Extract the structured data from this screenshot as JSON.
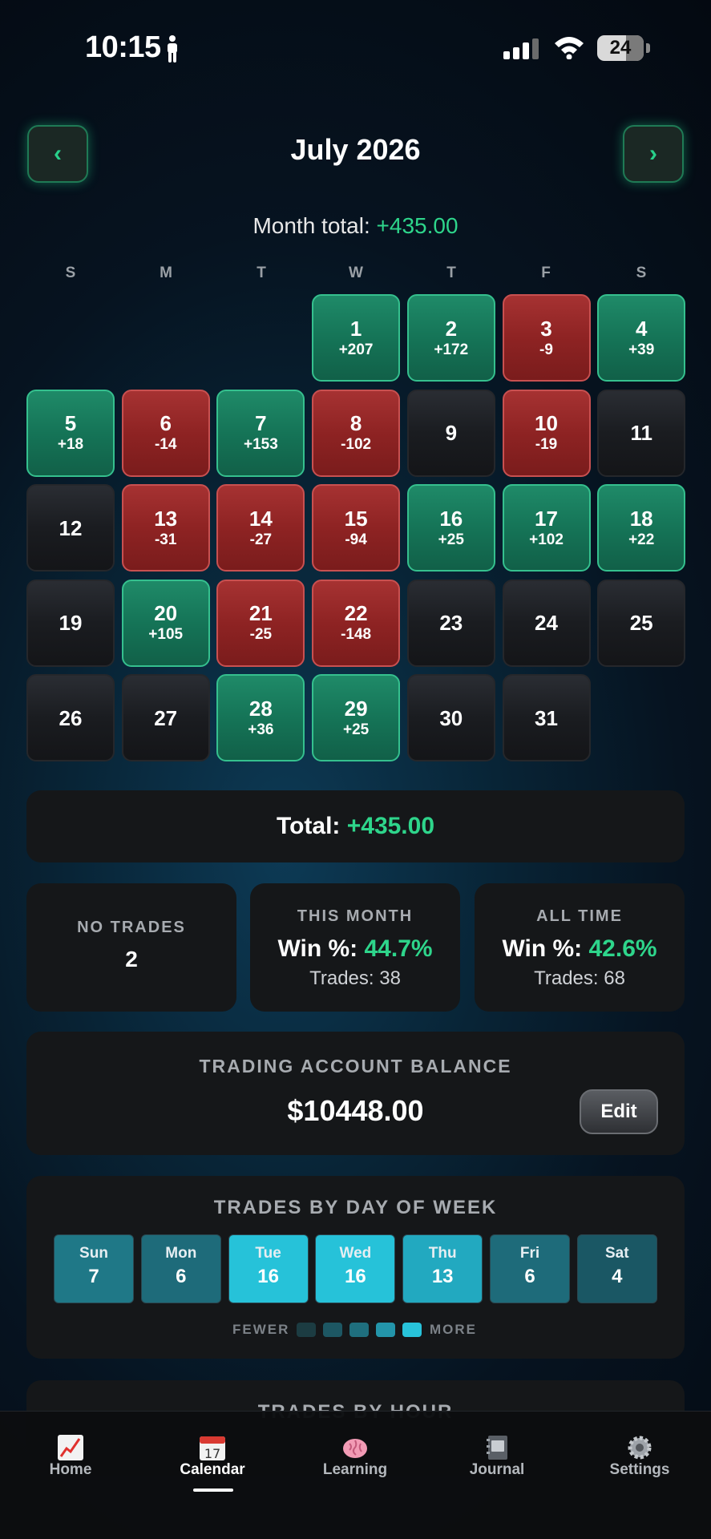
{
  "status_bar": {
    "time": "10:15",
    "battery": "24"
  },
  "header": {
    "prev_label": "‹",
    "next_label": "›",
    "title": "July 2026"
  },
  "month_total": {
    "label": "Month total: ",
    "value": "+435.00"
  },
  "weekdays": [
    "S",
    "M",
    "T",
    "W",
    "T",
    "F",
    "S"
  ],
  "calendar": [
    {
      "day": "1",
      "pnl": "+207",
      "status": "win"
    },
    {
      "day": "2",
      "pnl": "+172",
      "status": "win"
    },
    {
      "day": "3",
      "pnl": "-9",
      "status": "loss"
    },
    {
      "day": "4",
      "pnl": "+39",
      "status": "win"
    },
    {
      "day": "5",
      "pnl": "+18",
      "status": "win"
    },
    {
      "day": "6",
      "pnl": "-14",
      "status": "loss"
    },
    {
      "day": "7",
      "pnl": "+153",
      "status": "win"
    },
    {
      "day": "8",
      "pnl": "-102",
      "status": "loss"
    },
    {
      "day": "9",
      "pnl": "",
      "status": "none"
    },
    {
      "day": "10",
      "pnl": "-19",
      "status": "loss"
    },
    {
      "day": "11",
      "pnl": "",
      "status": "none"
    },
    {
      "day": "12",
      "pnl": "",
      "status": "none"
    },
    {
      "day": "13",
      "pnl": "-31",
      "status": "loss"
    },
    {
      "day": "14",
      "pnl": "-27",
      "status": "loss"
    },
    {
      "day": "15",
      "pnl": "-94",
      "status": "loss"
    },
    {
      "day": "16",
      "pnl": "+25",
      "status": "win"
    },
    {
      "day": "17",
      "pnl": "+102",
      "status": "win"
    },
    {
      "day": "18",
      "pnl": "+22",
      "status": "win"
    },
    {
      "day": "19",
      "pnl": "",
      "status": "none"
    },
    {
      "day": "20",
      "pnl": "+105",
      "status": "win"
    },
    {
      "day": "21",
      "pnl": "-25",
      "status": "loss"
    },
    {
      "day": "22",
      "pnl": "-148",
      "status": "loss"
    },
    {
      "day": "23",
      "pnl": "",
      "status": "none"
    },
    {
      "day": "24",
      "pnl": "",
      "status": "none"
    },
    {
      "day": "25",
      "pnl": "",
      "status": "none"
    },
    {
      "day": "26",
      "pnl": "",
      "status": "none"
    },
    {
      "day": "27",
      "pnl": "",
      "status": "none"
    },
    {
      "day": "28",
      "pnl": "+36",
      "status": "win"
    },
    {
      "day": "29",
      "pnl": "+25",
      "status": "win"
    },
    {
      "day": "30",
      "pnl": "",
      "status": "none"
    },
    {
      "day": "31",
      "pnl": "",
      "status": "none"
    }
  ],
  "total": {
    "label": "Total: ",
    "value": "+435.00"
  },
  "stats": {
    "no_trades": {
      "label": "NO TRADES",
      "value": "2"
    },
    "this_month": {
      "label": "THIS MONTH",
      "win_label": "Win %: ",
      "win_value": "44.7%",
      "trades": "Trades: 38"
    },
    "all_time": {
      "label": "ALL TIME",
      "win_label": "Win %: ",
      "win_value": "42.6%",
      "trades": "Trades: 68"
    }
  },
  "balance": {
    "label": "TRADING ACCOUNT BALANCE",
    "value": "$10448.00",
    "edit_label": "Edit"
  },
  "trades_by_day": {
    "title": "TRADES BY DAY OF WEEK",
    "days": [
      {
        "name": "Sun",
        "count": "7",
        "color": "#1f7887"
      },
      {
        "name": "Mon",
        "count": "6",
        "color": "#1e6b7a"
      },
      {
        "name": "Tue",
        "count": "16",
        "color": "#26c2d9"
      },
      {
        "name": "Wed",
        "count": "16",
        "color": "#26c2d9"
      },
      {
        "name": "Thu",
        "count": "13",
        "color": "#22a9c0"
      },
      {
        "name": "Fri",
        "count": "6",
        "color": "#1e6b7a"
      },
      {
        "name": "Sat",
        "count": "4",
        "color": "#1a5764"
      }
    ],
    "legend_fewer": "FEWER",
    "legend_more": "MORE",
    "legend_colors": [
      "#1c3c42",
      "#1d5763",
      "#1f6f7e",
      "#2395aa",
      "#28c3da"
    ]
  },
  "trades_by_hour": {
    "title": "TRADES BY HOUR"
  },
  "tabs": [
    {
      "label": "Home",
      "icon": "chart-icon"
    },
    {
      "label": "Calendar",
      "icon": "calendar-icon",
      "calendar_num": "17"
    },
    {
      "label": "Learning",
      "icon": "brain-icon"
    },
    {
      "label": "Journal",
      "icon": "notebook-icon"
    },
    {
      "label": "Settings",
      "icon": "gear-icon"
    }
  ],
  "colors": {
    "accent_green": "#2ed58b",
    "win": "#157457",
    "loss": "#8e2323",
    "none": "#1a1c20"
  }
}
